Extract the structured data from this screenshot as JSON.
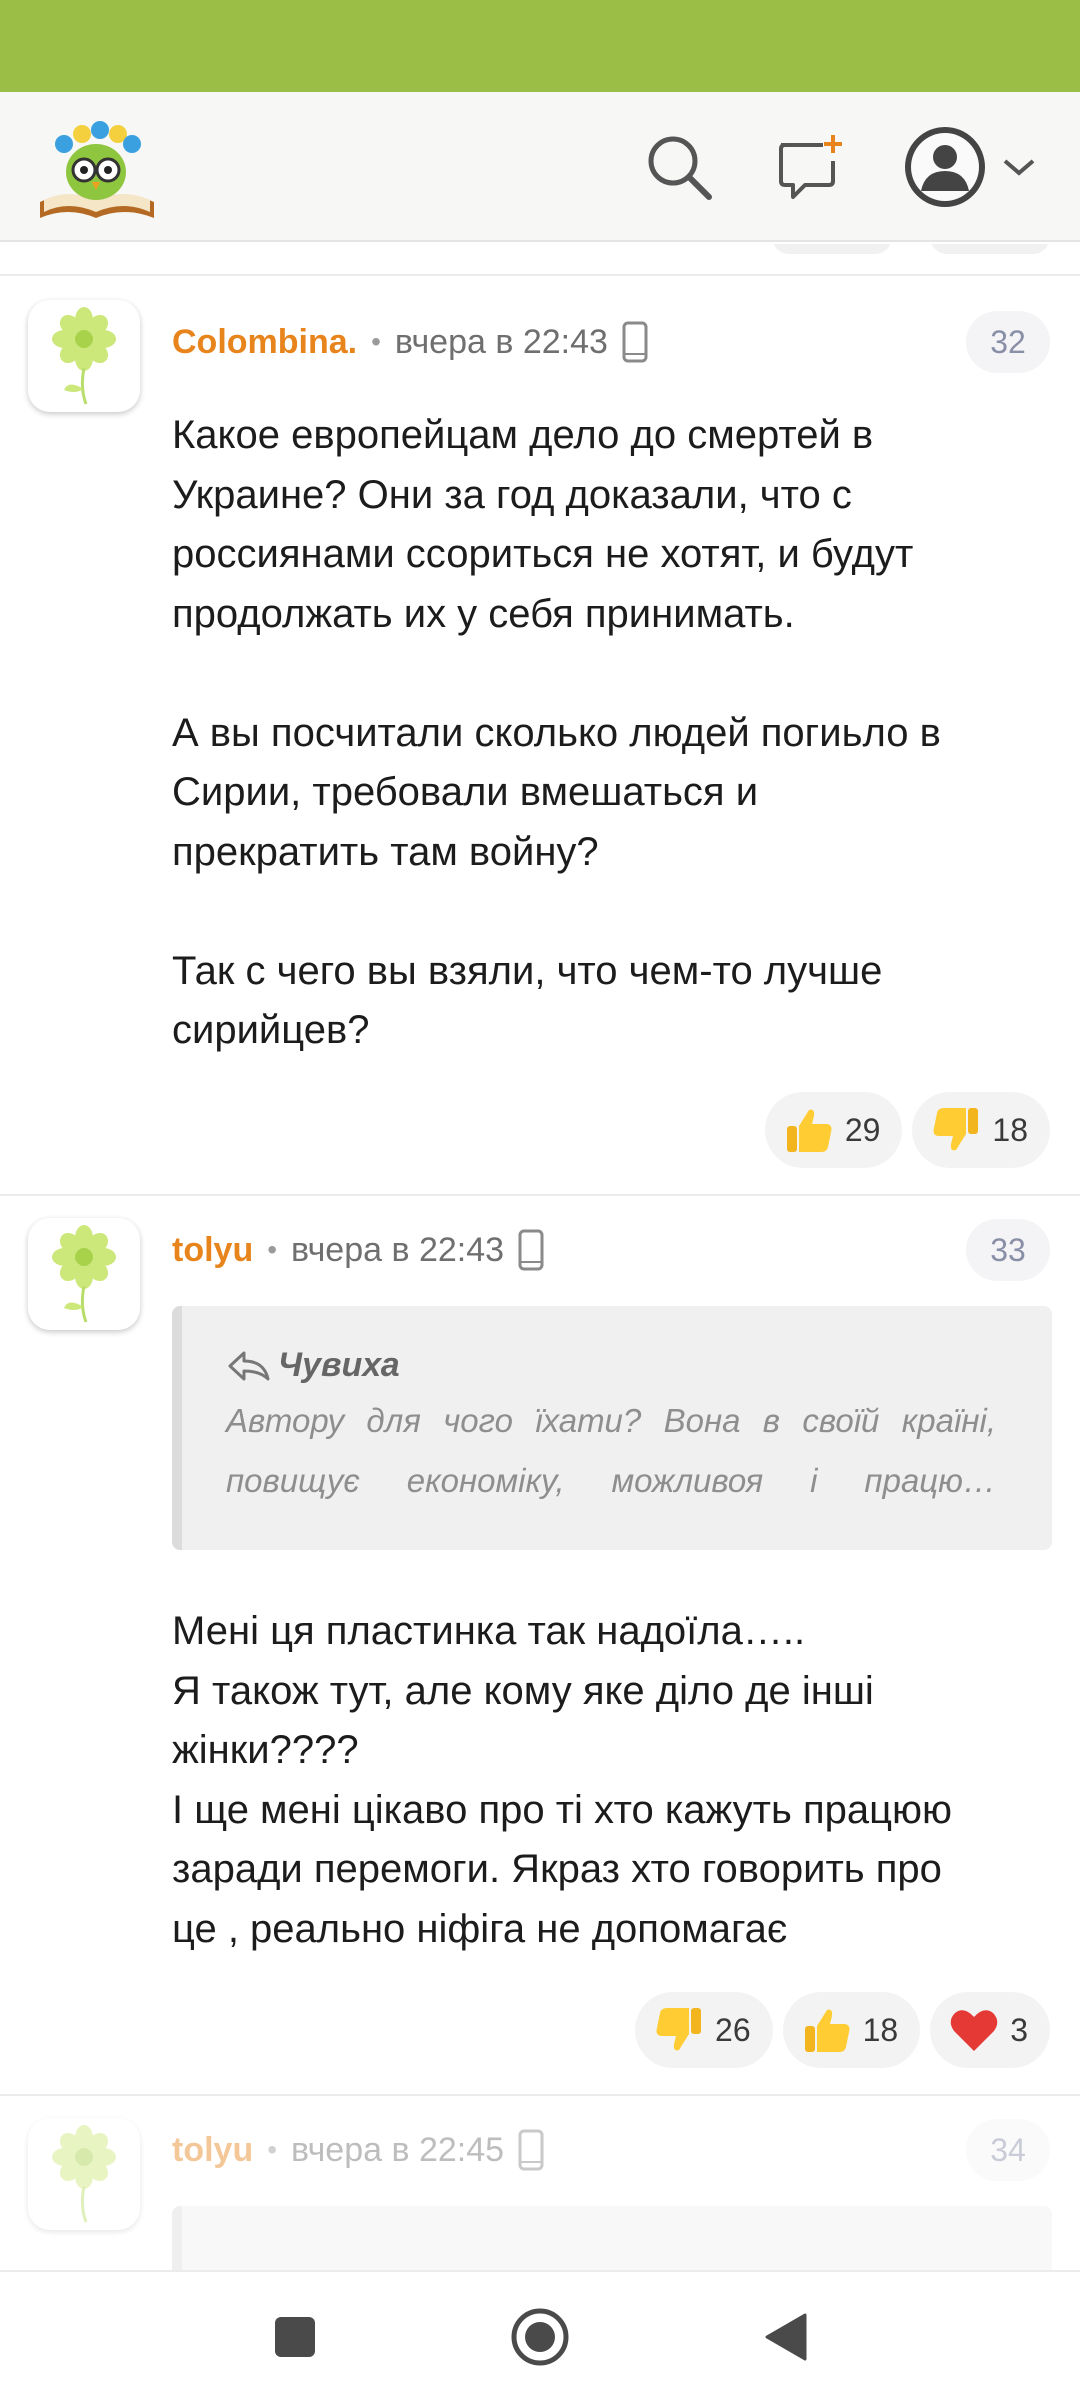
{
  "header": {
    "logo_icon": "owl-on-book-logo",
    "search_icon": "search-icon",
    "new_post_icon": "new-message-icon",
    "profile_icon": "user-avatar-icon"
  },
  "colors": {
    "status_bar": "#9bbf46",
    "author": "#e8841c",
    "badge_text": "#8a8fa8"
  },
  "comments": [
    {
      "author": "Colombina.",
      "time": "вчера в 22:43",
      "number": "32",
      "lines": [
        "Какое европейцам дело до смертей в",
        "Украине? Они за год доказали, что с",
        "россиянами ссориться не хотят, и будут",
        "продолжать их у себя принимать.",
        "",
        "А вы посчитали сколько людей погиьло в",
        "Сирии, требовали вмешаться и",
        "прекратить там войну?",
        "",
        "Так с чего вы взяли, что чем-то лучше",
        "сирийцев?"
      ],
      "reactions": [
        {
          "icon": "thumbs-up-icon",
          "count": "29"
        },
        {
          "icon": "thumbs-down-icon",
          "count": "18"
        }
      ]
    },
    {
      "author": "tolyu",
      "time": "вчера в 22:43",
      "number": "33",
      "quote": {
        "author": "Чувиха",
        "lines": [
          "Автору для чого їхати? Вона в своїй країні,",
          "повищує економіку, можливоя і працю…"
        ]
      },
      "lines": [
        "Мені ця пластинка так надоїла…..",
        "Я також тут, але кому яке діло де інші",
        "жінки????",
        "І ще мені цікаво про ті хто кажуть працюю",
        "заради перемоги. Якраз хто говорить про",
        "це , реально ніфіга не допомагає"
      ],
      "reactions": [
        {
          "icon": "thumbs-down-icon",
          "count": "26"
        },
        {
          "icon": "thumbs-up-icon",
          "count": "18"
        },
        {
          "icon": "heart-icon",
          "count": "3"
        }
      ]
    },
    {
      "author": "tolyu",
      "time": "вчера в 22:45",
      "number": "34"
    }
  ],
  "nav": {
    "recents_icon": "square-icon",
    "home_icon": "circle-home-icon",
    "back_icon": "triangle-back-icon"
  }
}
